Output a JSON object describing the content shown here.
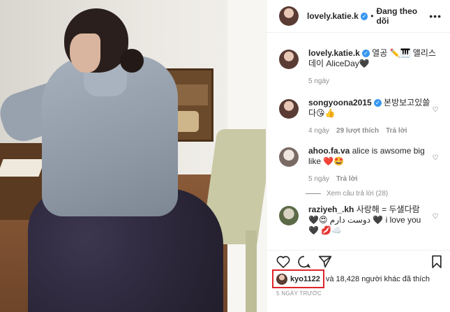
{
  "post": {
    "author": "lovely.katie.k",
    "follow_status": "Đang theo dõi",
    "caption": "열공 ✏️🎹 앨리스데이 AliceDay🖤",
    "caption_time": "5 ngày"
  },
  "comments": [
    {
      "user": "songyoona2015",
      "verified": true,
      "text": "본방보고있쓸다😘👍",
      "time": "4 ngày",
      "likes": "29 lượt thích",
      "reply": "Trả lời"
    },
    {
      "user": "ahoo.fa.va",
      "verified": false,
      "text": "alice is awsome big like ❤️🤩",
      "time": "5 ngày",
      "likes": "",
      "reply": "Trả lời",
      "view_replies": "Xem câu trả lời (28)"
    },
    {
      "user": "raziyeh_.kh",
      "verified": false,
      "text": "사랑해 = 두샐다람 🖤😍 دوست دارم 🖤 i love you 🖤 💋☁️",
      "time": "",
      "likes": "",
      "reply": ""
    }
  ],
  "likes_line": {
    "first_liker": "kyo1122",
    "rest": "và 18,428 người khác đã thích"
  },
  "timestamp": "5 NGÀY TRƯỚC",
  "icons": [
    "more-icon",
    "heart-icon",
    "comment-icon",
    "share-icon",
    "bookmark-icon",
    "verified-icon"
  ]
}
